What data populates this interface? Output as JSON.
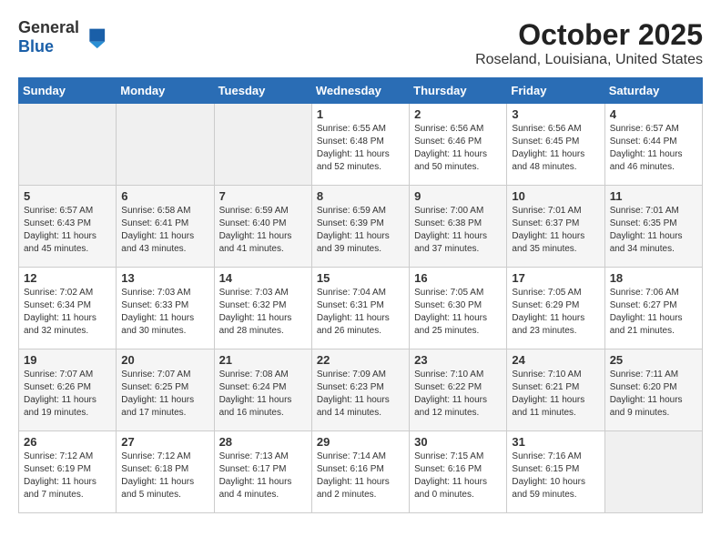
{
  "header": {
    "logo_general": "General",
    "logo_blue": "Blue",
    "month": "October 2025",
    "location": "Roseland, Louisiana, United States"
  },
  "weekdays": [
    "Sunday",
    "Monday",
    "Tuesday",
    "Wednesday",
    "Thursday",
    "Friday",
    "Saturday"
  ],
  "weeks": [
    [
      {
        "day": "",
        "info": ""
      },
      {
        "day": "",
        "info": ""
      },
      {
        "day": "",
        "info": ""
      },
      {
        "day": "1",
        "info": "Sunrise: 6:55 AM\nSunset: 6:48 PM\nDaylight: 11 hours\nand 52 minutes."
      },
      {
        "day": "2",
        "info": "Sunrise: 6:56 AM\nSunset: 6:46 PM\nDaylight: 11 hours\nand 50 minutes."
      },
      {
        "day": "3",
        "info": "Sunrise: 6:56 AM\nSunset: 6:45 PM\nDaylight: 11 hours\nand 48 minutes."
      },
      {
        "day": "4",
        "info": "Sunrise: 6:57 AM\nSunset: 6:44 PM\nDaylight: 11 hours\nand 46 minutes."
      }
    ],
    [
      {
        "day": "5",
        "info": "Sunrise: 6:57 AM\nSunset: 6:43 PM\nDaylight: 11 hours\nand 45 minutes."
      },
      {
        "day": "6",
        "info": "Sunrise: 6:58 AM\nSunset: 6:41 PM\nDaylight: 11 hours\nand 43 minutes."
      },
      {
        "day": "7",
        "info": "Sunrise: 6:59 AM\nSunset: 6:40 PM\nDaylight: 11 hours\nand 41 minutes."
      },
      {
        "day": "8",
        "info": "Sunrise: 6:59 AM\nSunset: 6:39 PM\nDaylight: 11 hours\nand 39 minutes."
      },
      {
        "day": "9",
        "info": "Sunrise: 7:00 AM\nSunset: 6:38 PM\nDaylight: 11 hours\nand 37 minutes."
      },
      {
        "day": "10",
        "info": "Sunrise: 7:01 AM\nSunset: 6:37 PM\nDaylight: 11 hours\nand 35 minutes."
      },
      {
        "day": "11",
        "info": "Sunrise: 7:01 AM\nSunset: 6:35 PM\nDaylight: 11 hours\nand 34 minutes."
      }
    ],
    [
      {
        "day": "12",
        "info": "Sunrise: 7:02 AM\nSunset: 6:34 PM\nDaylight: 11 hours\nand 32 minutes."
      },
      {
        "day": "13",
        "info": "Sunrise: 7:03 AM\nSunset: 6:33 PM\nDaylight: 11 hours\nand 30 minutes."
      },
      {
        "day": "14",
        "info": "Sunrise: 7:03 AM\nSunset: 6:32 PM\nDaylight: 11 hours\nand 28 minutes."
      },
      {
        "day": "15",
        "info": "Sunrise: 7:04 AM\nSunset: 6:31 PM\nDaylight: 11 hours\nand 26 minutes."
      },
      {
        "day": "16",
        "info": "Sunrise: 7:05 AM\nSunset: 6:30 PM\nDaylight: 11 hours\nand 25 minutes."
      },
      {
        "day": "17",
        "info": "Sunrise: 7:05 AM\nSunset: 6:29 PM\nDaylight: 11 hours\nand 23 minutes."
      },
      {
        "day": "18",
        "info": "Sunrise: 7:06 AM\nSunset: 6:27 PM\nDaylight: 11 hours\nand 21 minutes."
      }
    ],
    [
      {
        "day": "19",
        "info": "Sunrise: 7:07 AM\nSunset: 6:26 PM\nDaylight: 11 hours\nand 19 minutes."
      },
      {
        "day": "20",
        "info": "Sunrise: 7:07 AM\nSunset: 6:25 PM\nDaylight: 11 hours\nand 17 minutes."
      },
      {
        "day": "21",
        "info": "Sunrise: 7:08 AM\nSunset: 6:24 PM\nDaylight: 11 hours\nand 16 minutes."
      },
      {
        "day": "22",
        "info": "Sunrise: 7:09 AM\nSunset: 6:23 PM\nDaylight: 11 hours\nand 14 minutes."
      },
      {
        "day": "23",
        "info": "Sunrise: 7:10 AM\nSunset: 6:22 PM\nDaylight: 11 hours\nand 12 minutes."
      },
      {
        "day": "24",
        "info": "Sunrise: 7:10 AM\nSunset: 6:21 PM\nDaylight: 11 hours\nand 11 minutes."
      },
      {
        "day": "25",
        "info": "Sunrise: 7:11 AM\nSunset: 6:20 PM\nDaylight: 11 hours\nand 9 minutes."
      }
    ],
    [
      {
        "day": "26",
        "info": "Sunrise: 7:12 AM\nSunset: 6:19 PM\nDaylight: 11 hours\nand 7 minutes."
      },
      {
        "day": "27",
        "info": "Sunrise: 7:12 AM\nSunset: 6:18 PM\nDaylight: 11 hours\nand 5 minutes."
      },
      {
        "day": "28",
        "info": "Sunrise: 7:13 AM\nSunset: 6:17 PM\nDaylight: 11 hours\nand 4 minutes."
      },
      {
        "day": "29",
        "info": "Sunrise: 7:14 AM\nSunset: 6:16 PM\nDaylight: 11 hours\nand 2 minutes."
      },
      {
        "day": "30",
        "info": "Sunrise: 7:15 AM\nSunset: 6:16 PM\nDaylight: 11 hours\nand 0 minutes."
      },
      {
        "day": "31",
        "info": "Sunrise: 7:16 AM\nSunset: 6:15 PM\nDaylight: 10 hours\nand 59 minutes."
      },
      {
        "day": "",
        "info": ""
      }
    ]
  ]
}
